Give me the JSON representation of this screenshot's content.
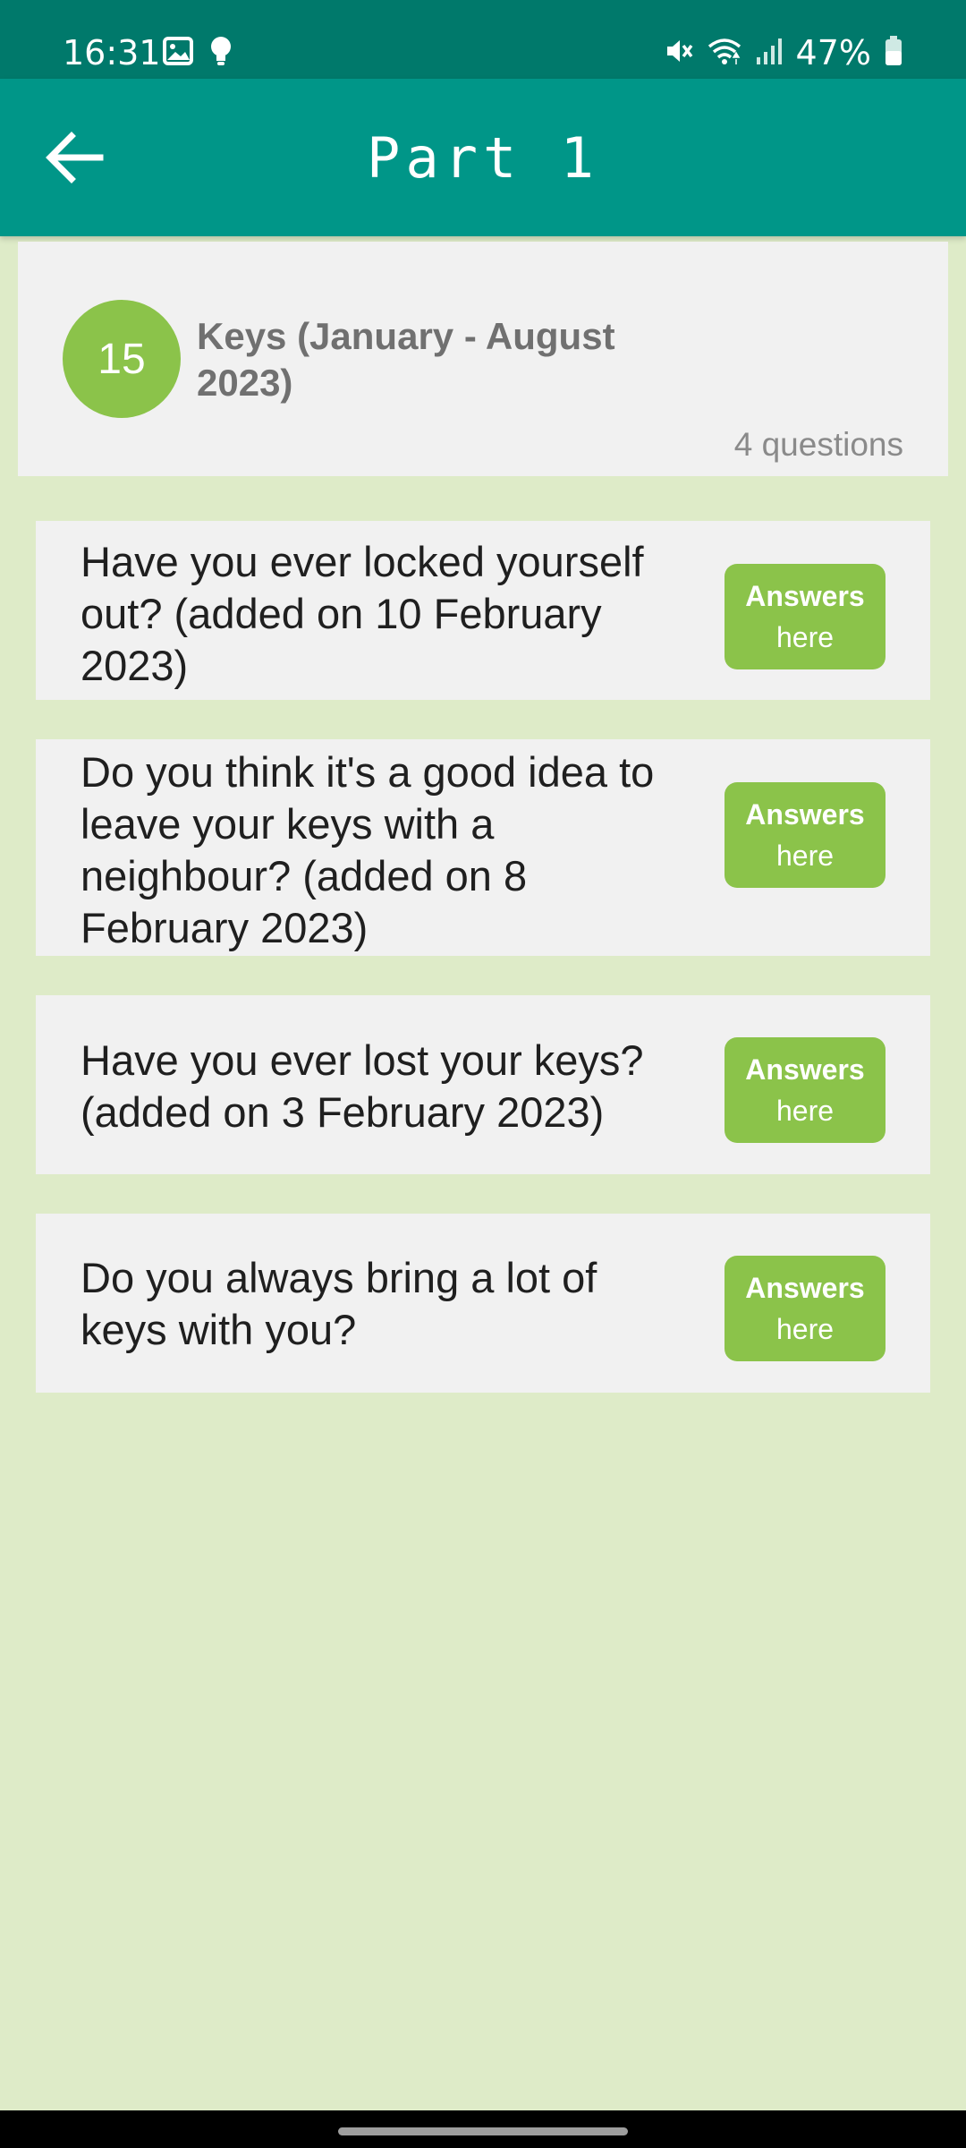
{
  "status_bar": {
    "time": "16:31",
    "left_icons": [
      "image-icon",
      "lightbulb-icon"
    ],
    "right_icons": [
      "mute-icon",
      "wifi-icon",
      "signal-icon",
      "battery-icon"
    ],
    "battery": "47%"
  },
  "app_bar": {
    "title": "Part 1",
    "back_icon": "arrow-left-icon"
  },
  "topic": {
    "number": "15",
    "title": "Keys (January - August 2023)",
    "question_count": "4 questions"
  },
  "questions": [
    {
      "text": "Have you ever locked yourself out? (added on 10 February 2023)",
      "button_line1": "Answers",
      "button_line2": "here"
    },
    {
      "text": "Do you think it's a good idea to leave your keys with a neighbour? (added on 8 February 2023)",
      "button_line1": "Answers",
      "button_line2": "here"
    },
    {
      "text": "Have you ever lost your keys? (added on 3 February 2023)",
      "button_line1": "Answers",
      "button_line2": "here"
    },
    {
      "text": "Do you always bring a lot of keys with you?",
      "button_line1": "Answers",
      "button_line2": "here"
    }
  ],
  "colors": {
    "status_bar": "#00796b",
    "app_bar": "#009688",
    "accent_green": "#8bc34a",
    "page_background": "#deebc8",
    "card_background": "#f1f1f1"
  }
}
